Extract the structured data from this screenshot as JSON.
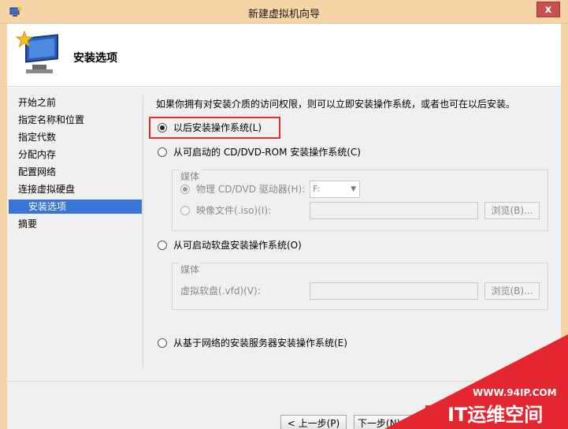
{
  "window": {
    "title": "新建虚拟机向导",
    "close_glyph": "x"
  },
  "header": {
    "title": "安装选项",
    "icon": "wizard-computer-star-icon"
  },
  "nav": {
    "items": [
      {
        "label": "开始之前",
        "selected": false
      },
      {
        "label": "指定名称和位置",
        "selected": false
      },
      {
        "label": "指定代数",
        "selected": false
      },
      {
        "label": "分配内存",
        "selected": false
      },
      {
        "label": "配置网络",
        "selected": false
      },
      {
        "label": "连接虚拟硬盘",
        "selected": false
      },
      {
        "label": "安装选项",
        "selected": true
      },
      {
        "label": "摘要",
        "selected": false
      }
    ]
  },
  "content": {
    "description": "如果你拥有对安装介质的访问权限，则可以立即安装操作系统，或者也可在以后安装。",
    "options": {
      "later": {
        "label": "以后安装操作系统(L)",
        "checked": true
      },
      "cd": {
        "label": "从可启动的 CD/DVD-ROM 安装操作系统(C)",
        "checked": false
      },
      "floppy": {
        "label": "从可启动软盘安装操作系统(O)",
        "checked": false
      },
      "network": {
        "label": "从基于网络的安装服务器安装操作系统(E)",
        "checked": false
      }
    },
    "cd_group": {
      "legend": "媒体",
      "physical_label": "物理 CD/DVD 驱动器(H):",
      "physical_value": "F:",
      "iso_label": "映像文件(.iso)(I):",
      "iso_value": "",
      "browse_label": "浏览(B)..."
    },
    "floppy_group": {
      "legend": "媒体",
      "vfd_label": "虚拟软盘(.vfd)(V):",
      "vfd_value": "",
      "browse_label": "浏览(B)..."
    }
  },
  "footer": {
    "prev_label": "< 上一步(P)",
    "next_label": "下一步(N) >",
    "finish_partial": "完"
  },
  "watermark": {
    "url": "WWW.94IP.COM",
    "brand": "IT运维空间"
  },
  "colors": {
    "titlebar": "#f6d5a6",
    "selected_nav": "#3875d7",
    "highlight_red": "#e03030",
    "watermark_red": "#e3262f"
  }
}
